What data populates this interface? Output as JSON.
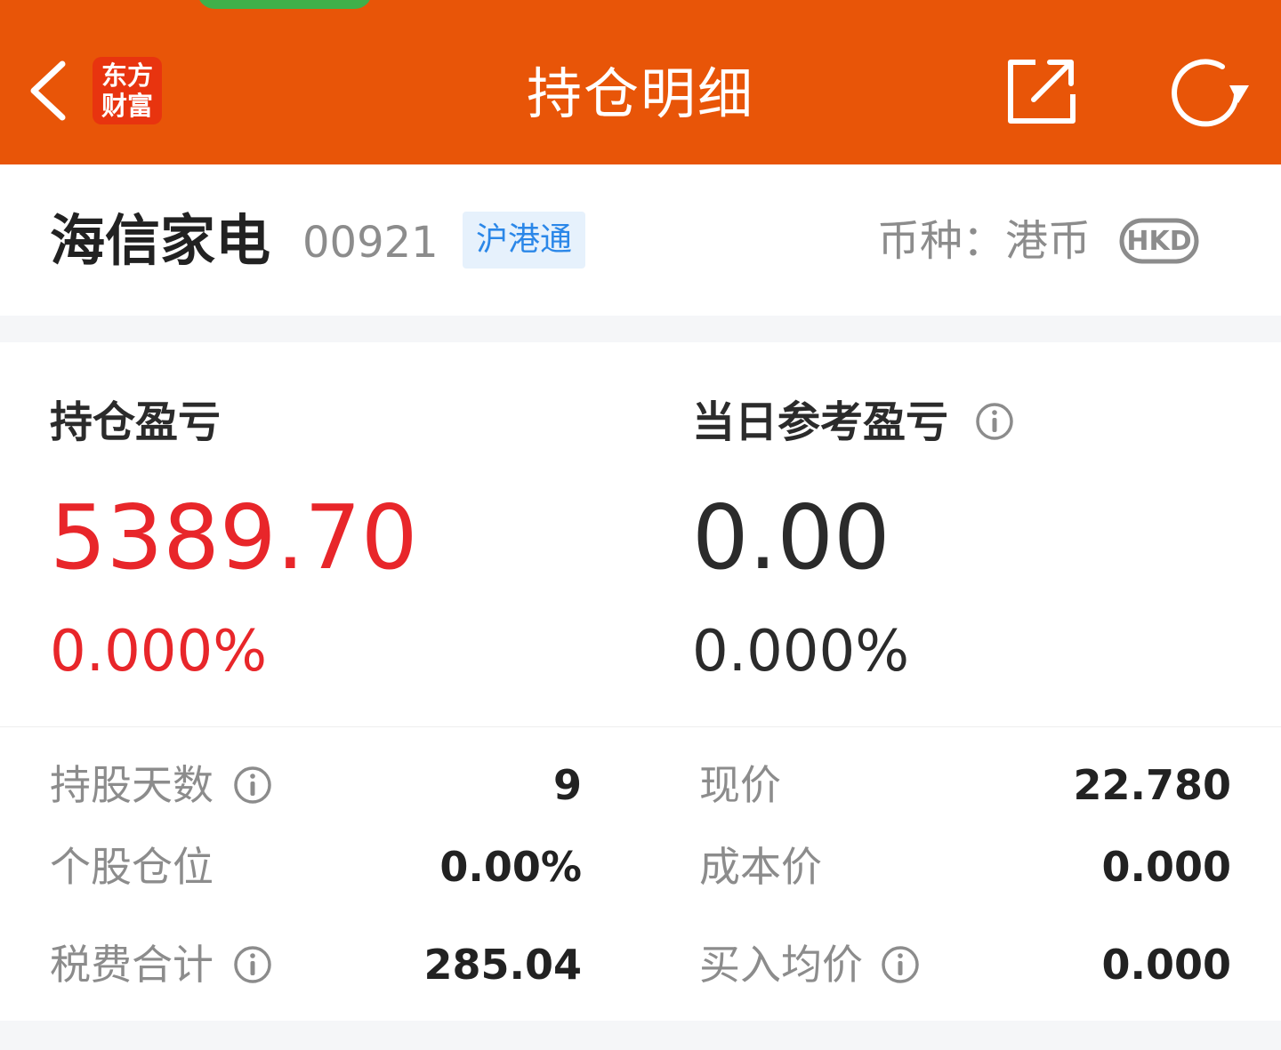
{
  "header": {
    "title": "持仓明细",
    "logo_line1": "东方",
    "logo_line2": "财富",
    "back_icon": "chevron-left-icon",
    "share_icon": "share-icon",
    "refresh_icon": "refresh-icon",
    "bg_color": "#e85508"
  },
  "stock": {
    "name": "海信家电",
    "code": "00921",
    "tag": "沪港通",
    "currency_label": "币种：港币",
    "currency_badge": "HKD"
  },
  "pl": {
    "holding_label": "持仓盈亏",
    "holding_value": "5389.70",
    "holding_pct": "0.000%",
    "today_label": "当日参考盈亏",
    "today_value": "0.00",
    "today_pct": "0.000%",
    "positive_color": "#e8262a"
  },
  "details": {
    "left": [
      {
        "label": "持股天数",
        "value": "9",
        "info": true
      },
      {
        "label": "个股仓位",
        "value": "0.00%",
        "info": false
      },
      {
        "label": "税费合计",
        "value": "285.04",
        "info": true
      }
    ],
    "right": [
      {
        "label": "现价",
        "value": "22.780",
        "info": false
      },
      {
        "label": "成本价",
        "value": "0.000",
        "info": false
      },
      {
        "label": "买入均价",
        "value": "0.000",
        "info": true
      }
    ]
  }
}
